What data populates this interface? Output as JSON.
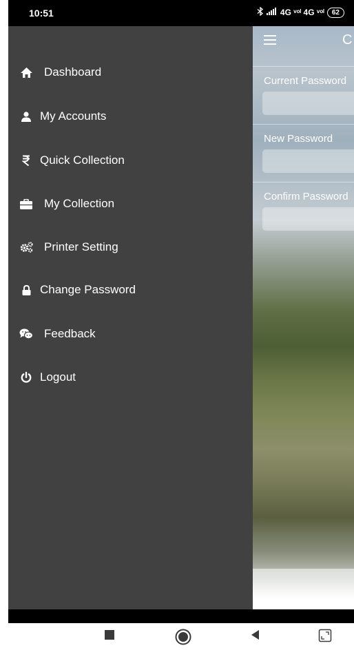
{
  "status_bar": {
    "time": "10:51",
    "network_text": "4G ᵛᵒˡ 4G ᵛᵒˡ",
    "battery": "62"
  },
  "background_page": {
    "title_partial": "C",
    "fields": [
      {
        "label": "Current Password"
      },
      {
        "label": "New Password"
      },
      {
        "label": "Confirm Password"
      }
    ]
  },
  "drawer": {
    "items": [
      {
        "label": "Dashboard",
        "icon": "home-icon"
      },
      {
        "label": "My Accounts",
        "icon": "user-icon"
      },
      {
        "label": "Quick Collection",
        "icon": "rupee-icon"
      },
      {
        "label": "My Collection",
        "icon": "briefcase-icon"
      },
      {
        "label": "Printer Setting",
        "icon": "gears-icon"
      },
      {
        "label": "Change Password",
        "icon": "lock-icon"
      },
      {
        "label": "Feedback",
        "icon": "chat-icon"
      },
      {
        "label": "Logout",
        "icon": "power-icon"
      }
    ]
  },
  "colors": {
    "drawer_bg": "#414141",
    "text": "#ffffff"
  }
}
